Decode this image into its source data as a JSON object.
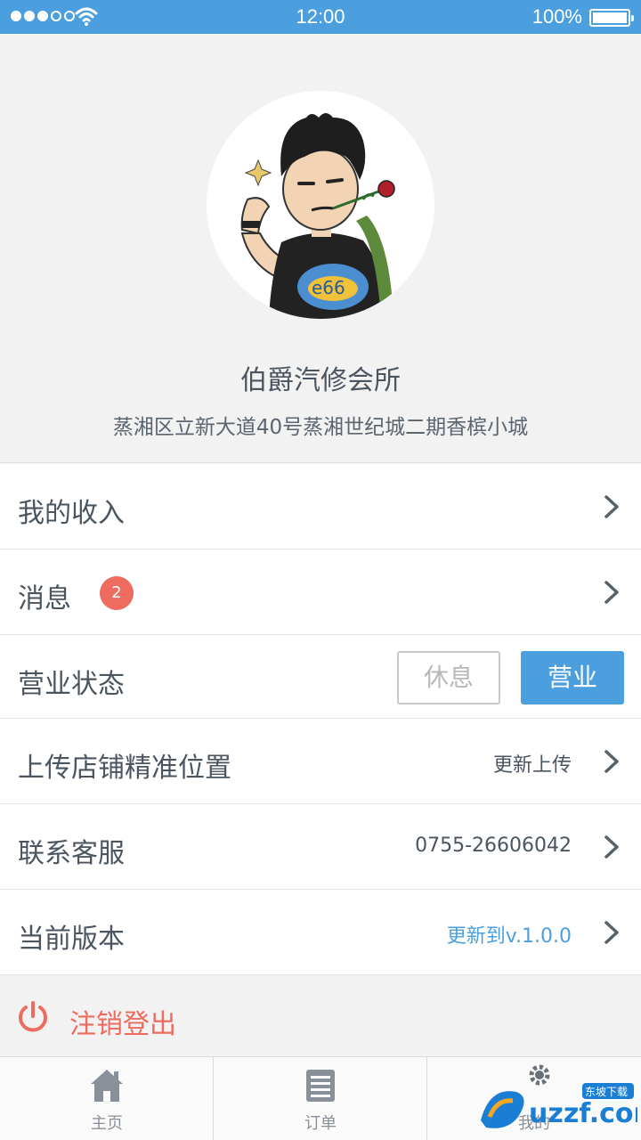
{
  "status_bar": {
    "time": "12:00",
    "battery": "100%",
    "signal_icon": "signal-dots-icon",
    "wifi_icon": "wifi-icon",
    "battery_icon": "battery-icon"
  },
  "profile": {
    "avatar_icon": "cartoon-avatar",
    "name": "伯爵汽修会所",
    "address": "蒸湘区立新大道40号蒸湘世纪城二期香槟小城"
  },
  "menu": {
    "income": {
      "label": "我的收入"
    },
    "messages": {
      "label": "消息",
      "badge": "2"
    },
    "business_status": {
      "label": "营业状态",
      "rest": "休息",
      "open": "营业",
      "selected": "营业"
    },
    "location": {
      "label": "上传店铺精准位置",
      "value": "更新上传"
    },
    "service": {
      "label": "联系客服",
      "value": "0755-26606042"
    },
    "version": {
      "label": "当前版本",
      "value": "更新到v.1.0.0"
    }
  },
  "logout": {
    "label": "注销登出"
  },
  "tabs": [
    {
      "label": "主页",
      "icon": "home-icon"
    },
    {
      "label": "订单",
      "icon": "order-list-icon"
    },
    {
      "label": "我的",
      "icon": "settings-icon"
    }
  ],
  "watermark": {
    "text": "uzzf.com",
    "tag": "东坡下载"
  },
  "colors": {
    "accent": "#4b9fde",
    "danger": "#ee6b5f",
    "text": "#4a5560",
    "background": "#f2f2f2"
  }
}
